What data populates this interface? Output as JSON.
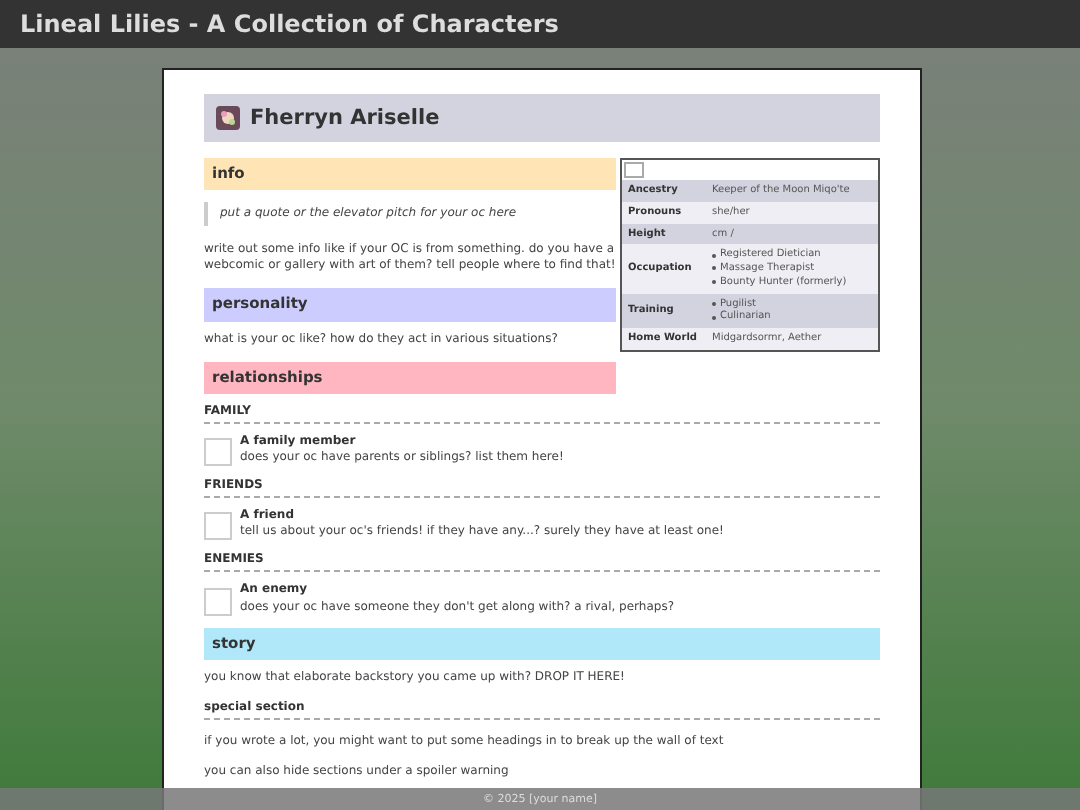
{
  "site_title": "Lineal Lilies - A Collection of Characters",
  "character": {
    "name": "Fherryn Ariselle"
  },
  "infobox": [
    {
      "label": "Ancestry",
      "values": [
        "Keeper of the Moon Miqo'te"
      ],
      "kind": "text"
    },
    {
      "label": "Pronouns",
      "values": [
        "she/her"
      ],
      "kind": "text"
    },
    {
      "label": "Height",
      "values": [
        "cm /"
      ],
      "kind": "text"
    },
    {
      "label": "Occupation",
      "values": [
        "Registered Dietician",
        "Massage Therapist",
        "Bounty Hunter (formerly)"
      ],
      "kind": "list"
    },
    {
      "label": "Training",
      "values": [
        "Pugilist",
        "Culinarian"
      ],
      "kind": "list"
    },
    {
      "label": "Home World",
      "values": [
        "Midgardsormr, Aether"
      ],
      "kind": "text"
    }
  ],
  "sections": [
    {
      "heading": "info",
      "color": "#ffe4b5",
      "blocks": [
        {
          "kind": "quote",
          "text": "put a quote or the elevator pitch for your oc here"
        },
        {
          "kind": "text",
          "text": "write out some info like if your OC is from something. do you have a webcomic or gallery with art of them? tell people where to find that!"
        }
      ]
    },
    {
      "heading": "personality",
      "color": "#ccccff",
      "blocks": [
        {
          "kind": "text",
          "text": "what is your oc like? how do they act in various situations?"
        }
      ]
    },
    {
      "heading": "relationships",
      "color": "#ffb6c1",
      "blocks": [
        {
          "kind": "group",
          "text": "FAMILY"
        },
        {
          "kind": "entry",
          "name": "A family member",
          "text": "does your oc have parents or siblings? list them here!"
        },
        {
          "kind": "group",
          "text": "FRIENDS"
        },
        {
          "kind": "entry",
          "name": "A friend",
          "text": "tell us about your oc's friends! if they have any...? surely they have at least one!"
        },
        {
          "kind": "group",
          "text": "ENEMIES"
        },
        {
          "kind": "entry",
          "name": "An enemy",
          "text": "does your oc have someone they don't get along with? a rival, perhaps?"
        }
      ]
    },
    {
      "heading": "story",
      "color": "#b0e8fa",
      "blocks": [
        {
          "kind": "text",
          "text": "you know that elaborate backstory you came up with? DROP IT HERE!"
        },
        {
          "kind": "subheading",
          "text": "special section"
        },
        {
          "kind": "text",
          "text": "if you wrote a lot, you might want to put some headings in to break up the wall of text"
        },
        {
          "kind": "text",
          "text": "you can also hide sections under a spoiler warning"
        }
      ]
    }
  ],
  "footer": "© 2025 [your name]"
}
